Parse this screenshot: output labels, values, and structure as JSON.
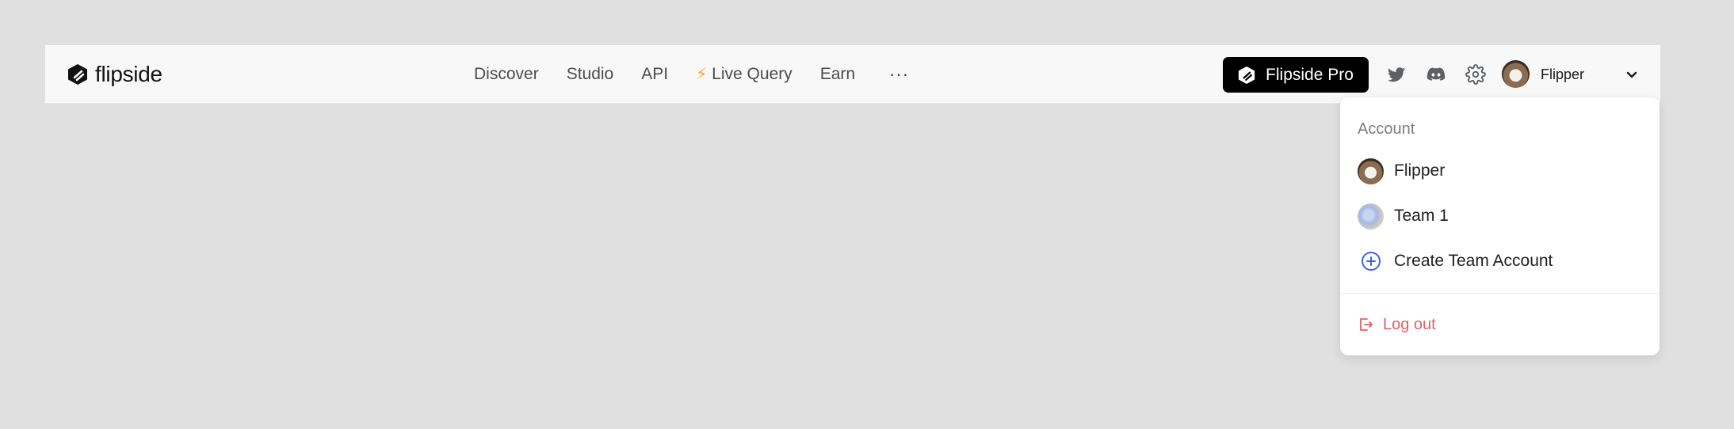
{
  "navbar": {
    "logo": {
      "text": "flipside",
      "icon": "flipside-logo-icon"
    },
    "links": [
      {
        "label": "Discover"
      },
      {
        "label": "Studio"
      },
      {
        "label": "API"
      },
      {
        "label": "Live Query",
        "icon": "lightning-icon",
        "icon_glyph": "⚡",
        "icon_color": "#f5a623"
      },
      {
        "label": "Earn"
      }
    ],
    "more_label": "···",
    "pro_button": {
      "label": "Flipside Pro",
      "icon": "flipside-logo-icon"
    },
    "social_icons": [
      "twitter-icon",
      "discord-icon",
      "gear-icon"
    ],
    "user": {
      "name": "Flipper"
    }
  },
  "dropdown": {
    "header": "Account",
    "accounts": [
      {
        "label": "Flipper",
        "icon": "avatar"
      },
      {
        "label": "Team 1",
        "icon": "team-avatar"
      }
    ],
    "create_team": {
      "label": "Create Team Account",
      "icon": "plus-circle-icon"
    },
    "logout": {
      "label": "Log out",
      "icon": "logout-icon"
    }
  },
  "colors": {
    "background": "#e0e0e0",
    "navbar_bg": "#f7f8f7",
    "pro_button_bg": "#000000",
    "accent_blue": "#3f5ef0",
    "logout_red": "#e0606a",
    "bolt_yellow": "#f5a623"
  }
}
